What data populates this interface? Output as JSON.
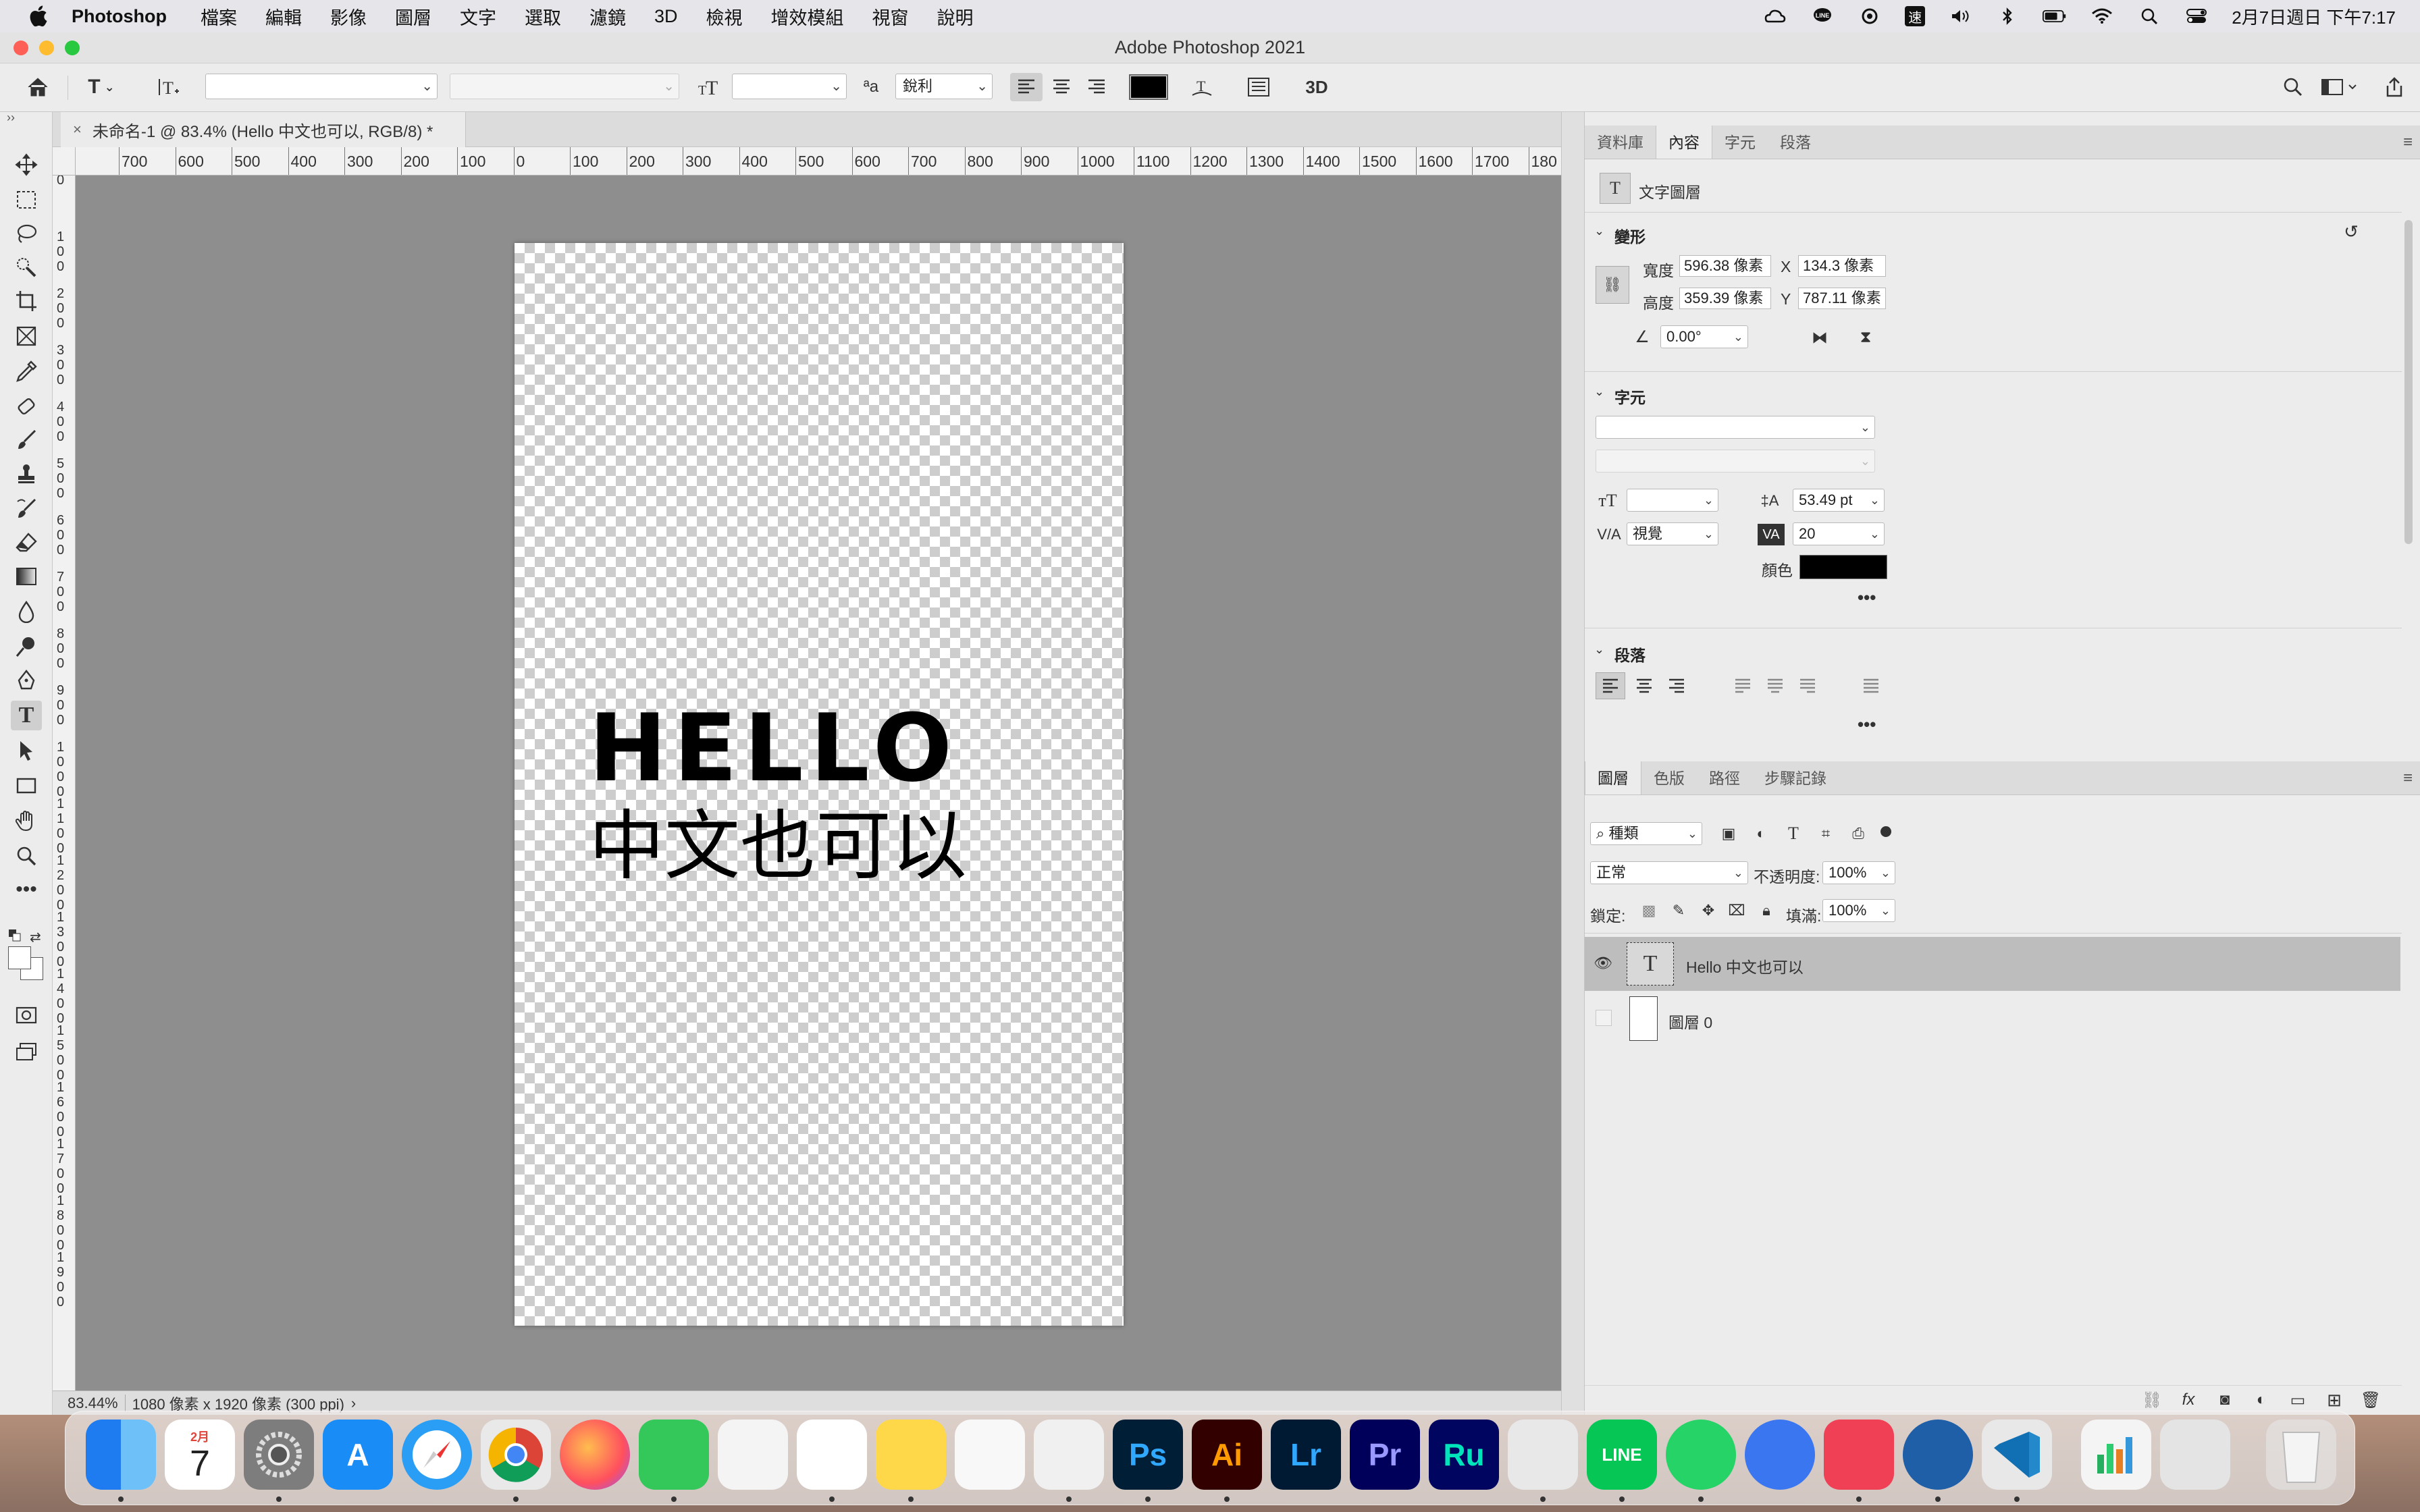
{
  "menubar": {
    "app": "Photoshop",
    "items": [
      "檔案",
      "編輯",
      "影像",
      "圖層",
      "文字",
      "選取",
      "濾鏡",
      "3D",
      "檢視",
      "增效模組",
      "視窗",
      "說明"
    ],
    "clock": "2月7日週日 下午7:17",
    "status_icons": [
      "creative-cloud-icon",
      "line-icon",
      "sync-icon",
      "input-method-icon",
      "volume-icon",
      "bluetooth-icon",
      "battery-icon",
      "wifi-icon",
      "spotlight-icon",
      "control-center-icon"
    ],
    "input_method_label": "速"
  },
  "window": {
    "title": "Adobe Photoshop 2021",
    "traffic_colors": [
      "#fe5f57",
      "#febc2e",
      "#28c840"
    ]
  },
  "options_bar": {
    "font_family": "",
    "font_style": "",
    "font_size": "",
    "antialias": "銳利",
    "antialias_prefix": "ªa",
    "text_color": "#000000",
    "three_d_label": "3D"
  },
  "document": {
    "tab_title": "未命名-1 @ 83.4% (Hello 中文也可以, RGB/8) *",
    "line1": "HELLO",
    "line2": "中文也可以"
  },
  "ruler": {
    "h_labels": [
      "700",
      "600",
      "500",
      "400",
      "300",
      "200",
      "100",
      "0",
      "100",
      "200",
      "300",
      "400",
      "500",
      "600",
      "700",
      "800",
      "900",
      "1000",
      "1100",
      "1200",
      "1300",
      "1400",
      "1500",
      "1600",
      "1700",
      "180"
    ],
    "v_labels": [
      "0",
      "1\n0\n0",
      "2\n0\n0",
      "3\n0\n0",
      "4\n0\n0",
      "5\n0\n0",
      "6\n0\n0",
      "7\n0\n0",
      "8\n0\n0",
      "9\n0\n0",
      "1\n0\n0\n0",
      "1\n1\n0\n0",
      "1\n2\n0\n0",
      "1\n3\n0\n0",
      "1\n4\n0\n0",
      "1\n5\n0\n0",
      "1\n6\n0\n0",
      "1\n7\n0\n0",
      "1\n8\n0\n0",
      "1\n9\n0\n0"
    ]
  },
  "status": {
    "zoom": "83.44%",
    "info": "1080 像素 x 1920 像素 (300 ppi)"
  },
  "properties_panel": {
    "tabs": [
      "資料庫",
      "內容",
      "字元",
      "段落"
    ],
    "active_tab": 1,
    "layer_kind": "文字圖層",
    "transform": {
      "header": "變形",
      "width_label": "寬度",
      "width": "596.38 像素",
      "height_label": "高度",
      "height": "359.39 像素",
      "x_label": "X",
      "x": "134.3 像素",
      "y_label": "Y",
      "y": "787.11 像素",
      "angle": "0.00°"
    },
    "character": {
      "header": "字元",
      "font_family": "",
      "font_style": "",
      "font_size": "",
      "leading": "53.49 pt",
      "kerning": "視覺",
      "tracking": "20",
      "color_label": "顏色",
      "color": "#000000"
    },
    "paragraph": {
      "header": "段落"
    }
  },
  "layers_panel": {
    "tabs": [
      "圖層",
      "色版",
      "路徑",
      "步驟記錄"
    ],
    "active_tab": 0,
    "filter_kind": "種類",
    "blend_mode": "正常",
    "opacity_label": "不透明度:",
    "opacity": "100%",
    "lock_label": "鎖定:",
    "fill_label": "填滿:",
    "fill": "100%",
    "layers": [
      {
        "name": "Hello 中文也可以",
        "type": "text",
        "visible": true,
        "selected": true
      },
      {
        "name": "圖層 0",
        "type": "pixel",
        "visible": false,
        "selected": false
      }
    ],
    "footer_icons": [
      "link-icon",
      "fx-icon",
      "mask-icon",
      "adjustment-icon",
      "folder-icon",
      "new-layer-icon",
      "trash-icon"
    ]
  },
  "dock": {
    "calendar_month": "2月",
    "calendar_day": "7",
    "apps": [
      {
        "name": "finder",
        "label": "",
        "color": "#2f8ff0"
      },
      {
        "name": "calendar",
        "label": "",
        "color": "#ffffff"
      },
      {
        "name": "system-preferences",
        "label": "",
        "color": "#7d7d7d"
      },
      {
        "name": "app-store",
        "label": "A",
        "color": "#1a8cf5"
      },
      {
        "name": "safari",
        "label": "",
        "color": "#2a9ef5"
      },
      {
        "name": "chrome",
        "label": "",
        "color": "#e9e9e9"
      },
      {
        "name": "firefox",
        "label": "",
        "color": "#ff7139"
      },
      {
        "name": "facetime",
        "label": "",
        "color": "#34c759"
      },
      {
        "name": "photos",
        "label": "",
        "color": "#f4f4f4"
      },
      {
        "name": "reminders",
        "label": "",
        "color": "#ffffff"
      },
      {
        "name": "notes",
        "label": "",
        "color": "#ffd84a"
      },
      {
        "name": "pages",
        "label": "",
        "color": "#f8f8f8"
      },
      {
        "name": "keynote",
        "label": "",
        "color": "#f0f0f0"
      },
      {
        "name": "photoshop",
        "label": "Ps",
        "color": "#001e36"
      },
      {
        "name": "illustrator",
        "label": "Ai",
        "color": "#330000"
      },
      {
        "name": "lightroom",
        "label": "Lr",
        "color": "#001a33"
      },
      {
        "name": "premiere",
        "label": "Pr",
        "color": "#00005b"
      },
      {
        "name": "rush",
        "label": "Ru",
        "color": "#000560"
      },
      {
        "name": "sketchbook",
        "label": "",
        "color": "#e8e8e8"
      },
      {
        "name": "line",
        "label": "LINE",
        "color": "#06c755"
      },
      {
        "name": "whatsapp",
        "label": "",
        "color": "#25d366"
      },
      {
        "name": "signal",
        "label": "",
        "color": "#3a76f0"
      },
      {
        "name": "pocket",
        "label": "",
        "color": "#ef4056"
      },
      {
        "name": "vpn",
        "label": "",
        "color": "#1f5fa8"
      },
      {
        "name": "vscode",
        "label": "",
        "color": "#e8e8e8"
      },
      {
        "name": "numbers",
        "label": "",
        "color": "#f4f4f4"
      },
      {
        "name": "preview",
        "label": "",
        "color": "#e4e4e4"
      },
      {
        "name": "trash",
        "label": "",
        "color": "#e6e6e6"
      }
    ]
  }
}
